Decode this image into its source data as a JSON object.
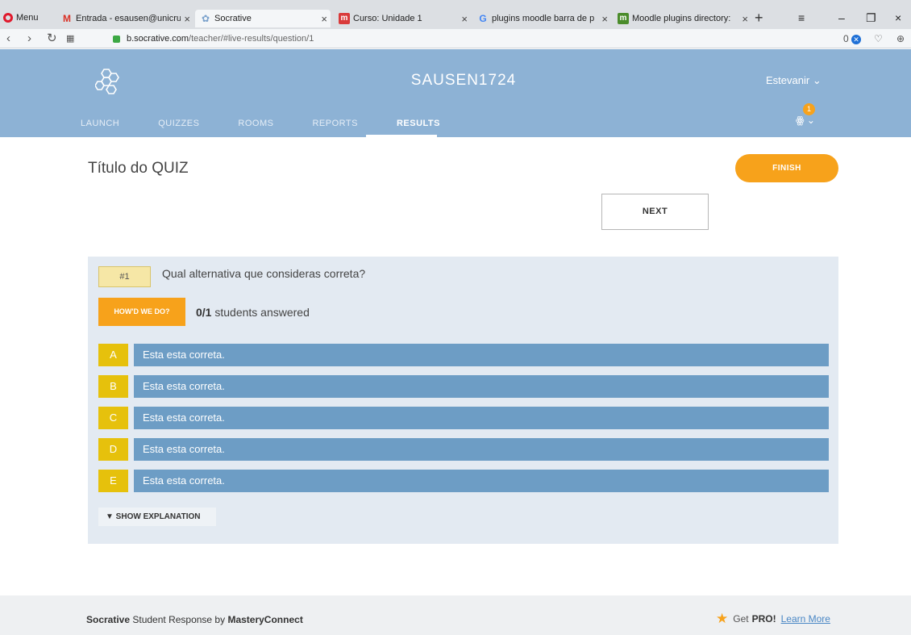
{
  "browser": {
    "menu_label": "Menu",
    "tabs": [
      {
        "title": "Entrada - esausen@unicru",
        "icon": "gmail-icon"
      },
      {
        "title": "Socrative",
        "icon": "socrative-icon"
      },
      {
        "title": "Curso: Unidade 1",
        "icon": "moodle-course-icon"
      },
      {
        "title": "plugins moodle barra de p",
        "icon": "google-icon"
      },
      {
        "title": "Moodle plugins directory:",
        "icon": "moodle-icon"
      }
    ],
    "url_host": "b.socrative.com",
    "url_path": "/teacher/#live-results/question/1",
    "badge_count": "0"
  },
  "header": {
    "room_name": "SAUSEN1724",
    "user_name": "Estevanir",
    "notification_count": "1",
    "nav": [
      {
        "label": "LAUNCH"
      },
      {
        "label": "QUIZZES"
      },
      {
        "label": "ROOMS"
      },
      {
        "label": "REPORTS"
      },
      {
        "label": "RESULTS",
        "active": true
      }
    ]
  },
  "main": {
    "quiz_title": "Título do QUIZ",
    "finish_label": "FINISH",
    "next_label": "NEXT",
    "question": {
      "number": "#1",
      "text": "Qual alternativa que consideras correta?",
      "howd_label": "HOW'D WE DO?",
      "answered_count": "0/1",
      "answered_suffix": " students answered",
      "answers": [
        {
          "letter": "A",
          "text": "Esta esta correta."
        },
        {
          "letter": "B",
          "text": "Esta esta correta."
        },
        {
          "letter": "C",
          "text": "Esta esta correta."
        },
        {
          "letter": "D",
          "text": "Esta esta correta."
        },
        {
          "letter": "E",
          "text": "Esta esta correta."
        }
      ],
      "explanation_label": "▼ SHOW EXPLANATION"
    }
  },
  "footer": {
    "brand": "Socrative",
    "middle": " Student Response by ",
    "company": "MasteryConnect",
    "get_text": "Get",
    "pro_text": "PRO!",
    "learn_more": "Learn More"
  },
  "colors": {
    "header_bg": "#8db2d5",
    "accent_orange": "#f7a21b",
    "answer_bar": "#6d9dc5",
    "answer_letter": "#e6c10c",
    "panel_bg": "#e3eaf2"
  }
}
